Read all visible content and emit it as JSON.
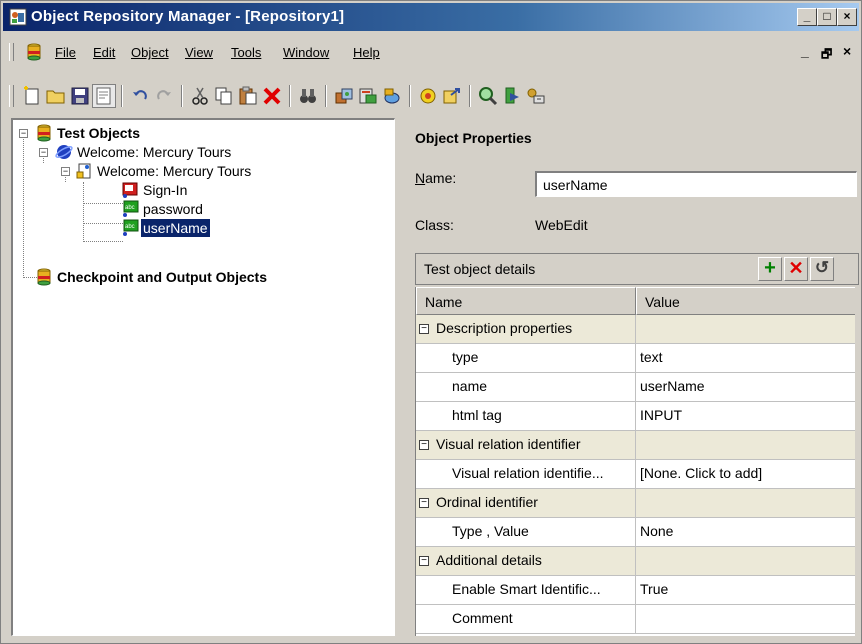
{
  "window": {
    "title": "Object Repository Manager - [Repository1]",
    "controls": {
      "minimize": "_",
      "maximize": "□",
      "close": "×"
    }
  },
  "menu": {
    "items": [
      "File",
      "Edit",
      "Object",
      "View",
      "Tools",
      "Window",
      "Help"
    ],
    "mdi_controls": {
      "minimize": "_",
      "restore": "🗗",
      "close": "×"
    }
  },
  "toolbar": {
    "buttons": [
      "new-repository",
      "open",
      "save",
      "properties",
      "undo",
      "redo",
      "cut",
      "copy",
      "paste",
      "delete",
      "find",
      "add-objects",
      "update-from-app",
      "define-new-test-object",
      "highlight",
      "export",
      "object-spy",
      "navigate-and-learn",
      "add-to-local"
    ]
  },
  "tree": {
    "root1": "Test Objects",
    "browser": "Welcome: Mercury Tours",
    "page": "Welcome: Mercury Tours",
    "items": [
      "Sign-In",
      "password",
      "userName"
    ],
    "root2": "Checkpoint and Output Objects"
  },
  "properties": {
    "section_title": "Object Properties",
    "name_label": "Name:",
    "name_value": "userName",
    "class_label": "Class:",
    "class_value": "WebEdit",
    "details_title": "Test object details"
  },
  "grid": {
    "headers": [
      "Name",
      "Value"
    ],
    "rows": [
      {
        "kind": "cat",
        "name": "Description properties",
        "value": ""
      },
      {
        "kind": "prop",
        "name": "type",
        "value": "text"
      },
      {
        "kind": "prop",
        "name": "name",
        "value": "userName"
      },
      {
        "kind": "prop",
        "name": "html tag",
        "value": "INPUT"
      },
      {
        "kind": "cat",
        "name": "Visual relation identifier",
        "value": ""
      },
      {
        "kind": "prop",
        "name": "Visual relation identifie...",
        "value": "[None. Click to add]"
      },
      {
        "kind": "cat",
        "name": "Ordinal identifier",
        "value": ""
      },
      {
        "kind": "prop",
        "name": "Type , Value",
        "value": "None"
      },
      {
        "kind": "cat",
        "name": "Additional details",
        "value": ""
      },
      {
        "kind": "prop",
        "name": "Enable Smart Identific...",
        "value": "True"
      },
      {
        "kind": "prop",
        "name": "Comment",
        "value": ""
      }
    ]
  },
  "colors": {
    "title_start": "#0a246a",
    "title_end": "#a6caf0",
    "selection": "#0a246a",
    "add_green": "#008000",
    "delete_red": "#e00000"
  }
}
